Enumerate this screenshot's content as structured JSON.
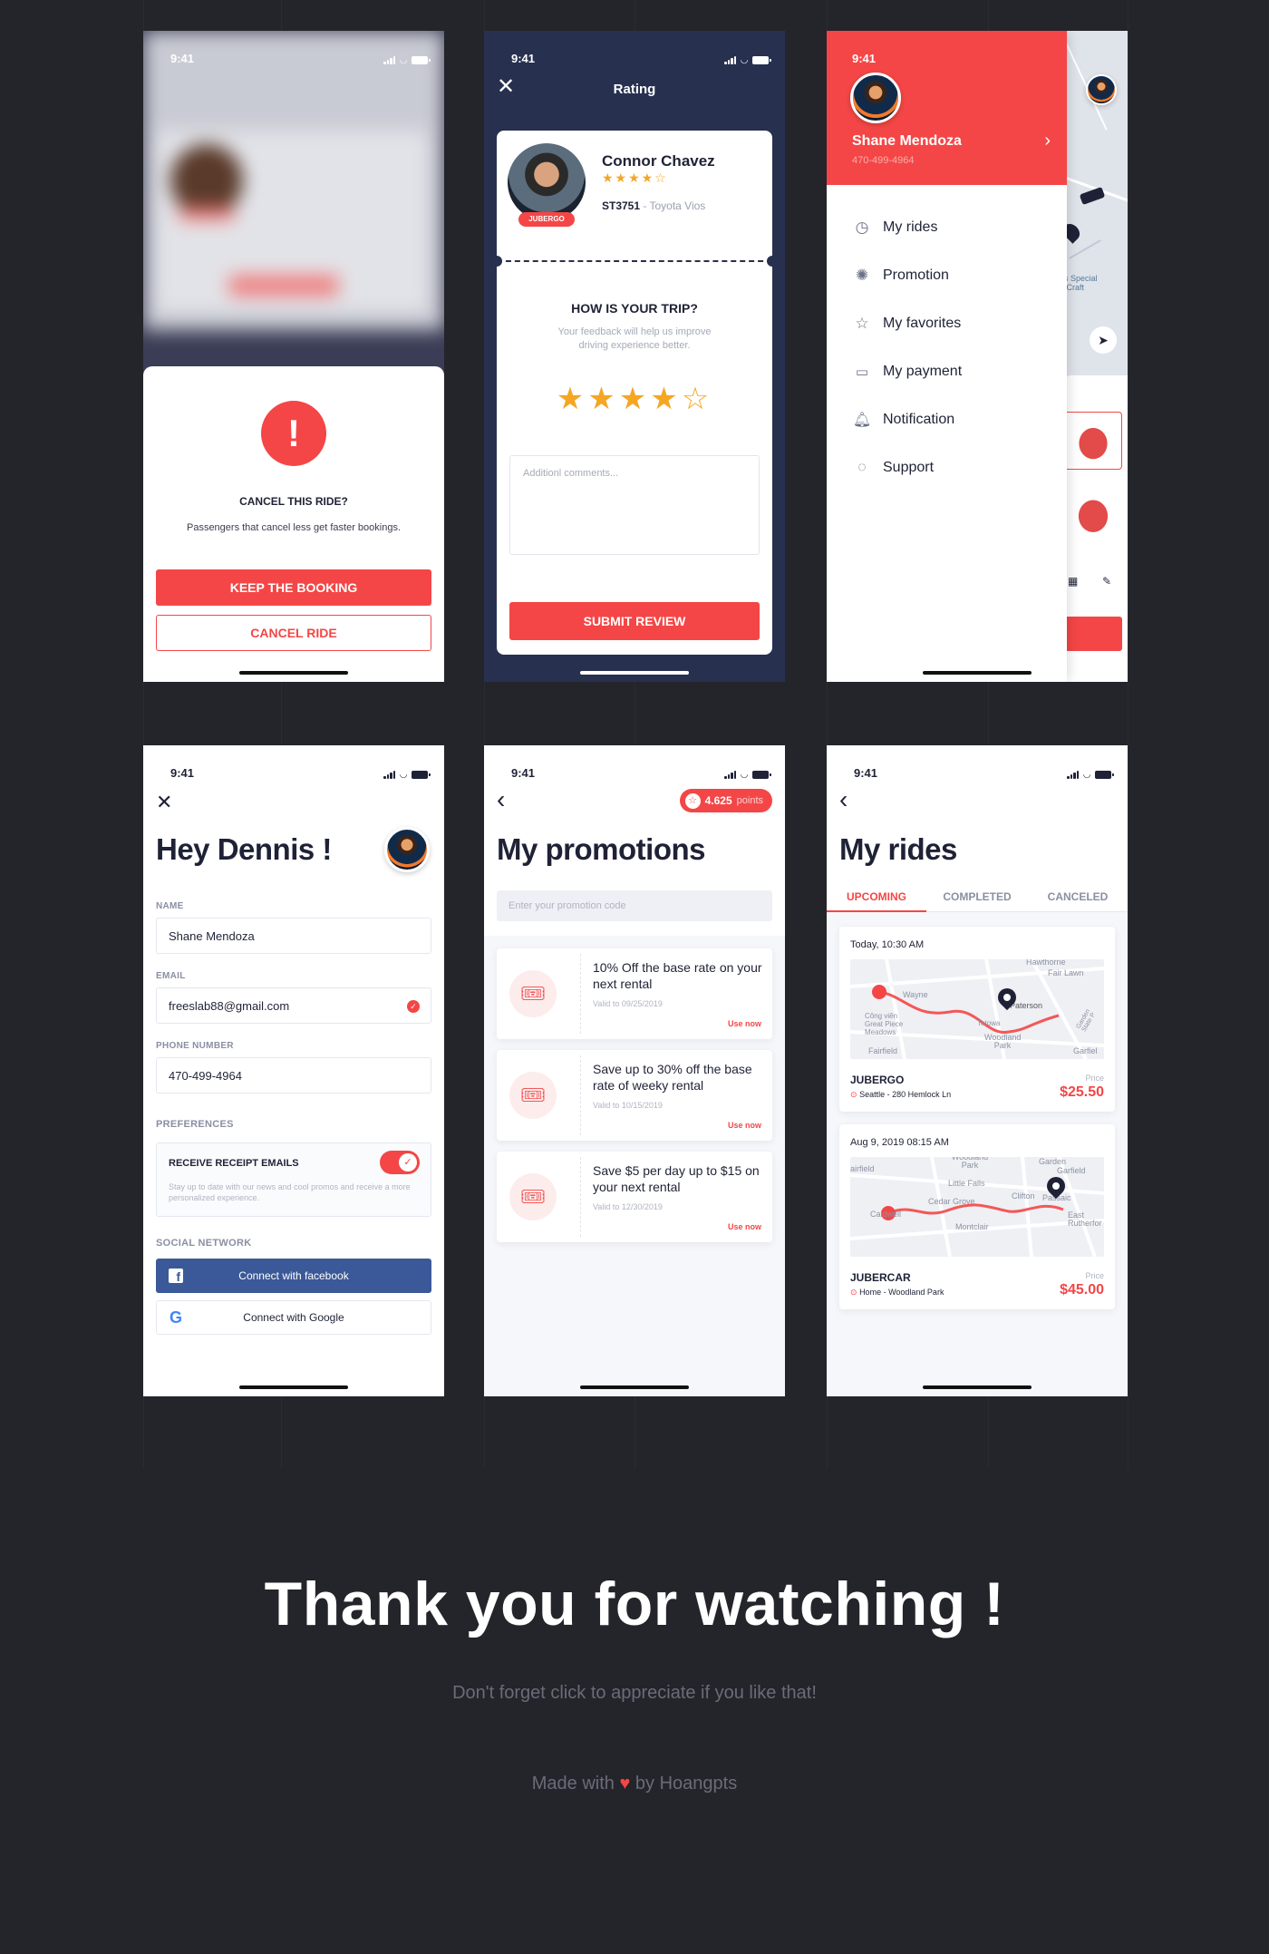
{
  "status_time": "9:41",
  "cancel_screen": {
    "title": "CANCEL THIS RIDE?",
    "subtitle": "Passengers that cancel less get faster bookings.",
    "keep_label": "KEEP THE BOOKING",
    "cancel_label": "CANCEL RIDE"
  },
  "rating_screen": {
    "header": "Rating",
    "driver_name": "Connor Chavez",
    "badge": "JUBERGO",
    "plate": "ST3751",
    "car": " - Toyota Vios",
    "question": "HOW IS YOUR TRIP?",
    "feedback_text": "Your feedback will help us improve driving experience better.",
    "comment_placeholder": "Additionl comments...",
    "submit_label": "SUBMIT REVIEW",
    "rating": 4
  },
  "menu_screen": {
    "user_name": "Shane Mendoza",
    "user_phone": "470-499-4964",
    "items": [
      {
        "label": "My rides",
        "icon": "clock-icon"
      },
      {
        "label": "Promotion",
        "icon": "badge-icon"
      },
      {
        "label": "My favorites",
        "icon": "star-icon"
      },
      {
        "label": "My payment",
        "icon": "card-icon"
      },
      {
        "label": "Notification",
        "icon": "bell-icon"
      },
      {
        "label": "Support",
        "icon": "chat-icon"
      }
    ],
    "map_label": "s Special\nCraft"
  },
  "profile_screen": {
    "greeting": "Hey Dennis !",
    "name_label": "NAME",
    "name_value": "Shane Mendoza",
    "email_label": "EMAIL",
    "email_value": "freeslab88@gmail.com",
    "phone_label": "PHONE NUMBER",
    "phone_value": "470-499-4964",
    "preferences_label": "PREFERENCES",
    "receipt_title": "RECEIVE RECEIPT EMAILS",
    "receipt_desc": "Stay up to date with our news and cool promos and receive a more personalized experience.",
    "receipt_enabled": true,
    "social_label": "SOCIAL NETWORK",
    "facebook_label": "Connect with facebook",
    "google_label": "Connect with Google"
  },
  "promotions_screen": {
    "points": "4.625",
    "points_unit": "points",
    "title": "My promotions",
    "code_placeholder": "Enter your promotion code",
    "promos": [
      {
        "title": "10% Off the base rate on your next rental",
        "valid": "Valid to 09/25/2019",
        "action": "Use now"
      },
      {
        "title": "Save up to 30% off the base rate of weeky rental",
        "valid": "Valid to 10/15/2019",
        "action": "Use now"
      },
      {
        "title": "Save $5 per day up to $15 on your next rental",
        "valid": "Valid to 12/30/2019",
        "action": "Use now"
      }
    ]
  },
  "rides_screen": {
    "title": "My rides",
    "tabs": [
      "UPCOMING",
      "COMPLETED",
      "CANCELED"
    ],
    "active_tab": "UPCOMING",
    "rides": [
      {
        "date": "Today, 10:30 AM",
        "service": "JUBERGO",
        "route": "Seattle - 280 Hemlock Ln",
        "price_label": "Price",
        "price": "$25.50",
        "map_labels": [
          "Hawthorne",
          "Fair Lawn",
          "Wayne",
          "Paterson",
          "Công viên Great Piece Meadows",
          "Totowa",
          "Woodland Park",
          "Fairfield",
          "Garden State P",
          "Garfiel"
        ]
      },
      {
        "date": "Aug 9, 2019 08:15 AM",
        "service": "JUBERCAR",
        "route": "Home - Woodland Park",
        "price_label": "Price",
        "price": "$45.00",
        "map_labels": [
          "Woodland Park",
          "Garden",
          "Garfield",
          "airfield",
          "Little Falls",
          "Cedar Grove",
          "Clifton",
          "Passaic",
          "Caldwell",
          "Montclair",
          "East Rutherfor"
        ]
      }
    ]
  },
  "footer": {
    "title": "Thank you for watching !",
    "subtitle": "Don't forget click to appreciate if you like that!",
    "made_with": "Made with",
    "by": "by Hoangpts"
  },
  "colors": {
    "accent": "#f44646",
    "navy": "#27304f",
    "facebook": "#3b5998",
    "star": "#f5a623",
    "background": "#24242b"
  }
}
